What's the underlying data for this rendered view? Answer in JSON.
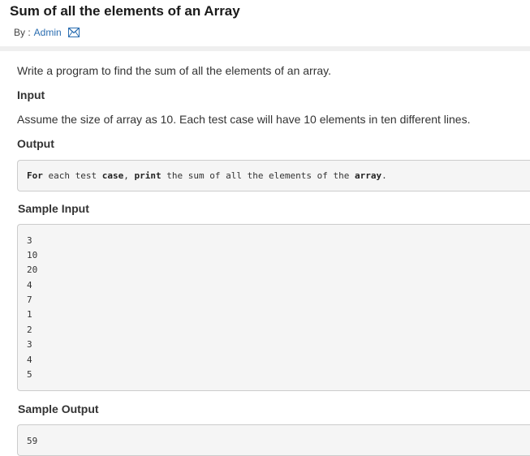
{
  "header": {
    "title": "Sum of all the elements of an Array",
    "by_label": "By :",
    "author": "Admin"
  },
  "content": {
    "intro": "Write a program to find the sum of all the elements of an array.",
    "input_heading": "Input",
    "input_text": "Assume the size of array as 10. Each test case will have 10 elements in ten different lines.",
    "output_heading": "Output",
    "output_code": {
      "parts": [
        "For",
        " each test ",
        "case",
        ", ",
        "print",
        " the sum of all the elements of the ",
        "array",
        "."
      ]
    },
    "sample_input_heading": "Sample Input",
    "sample_input_lines": [
      "3",
      "10",
      "20",
      "4",
      "7",
      "1",
      "2",
      "3",
      "4",
      "5"
    ],
    "sample_output_heading": "Sample Output",
    "sample_output_value": "59"
  },
  "colors": {
    "link": "#2a6db0",
    "code_bg": "#f5f5f5",
    "code_border": "#cccccc"
  },
  "icons": {
    "author_contact": "mail-icon"
  }
}
